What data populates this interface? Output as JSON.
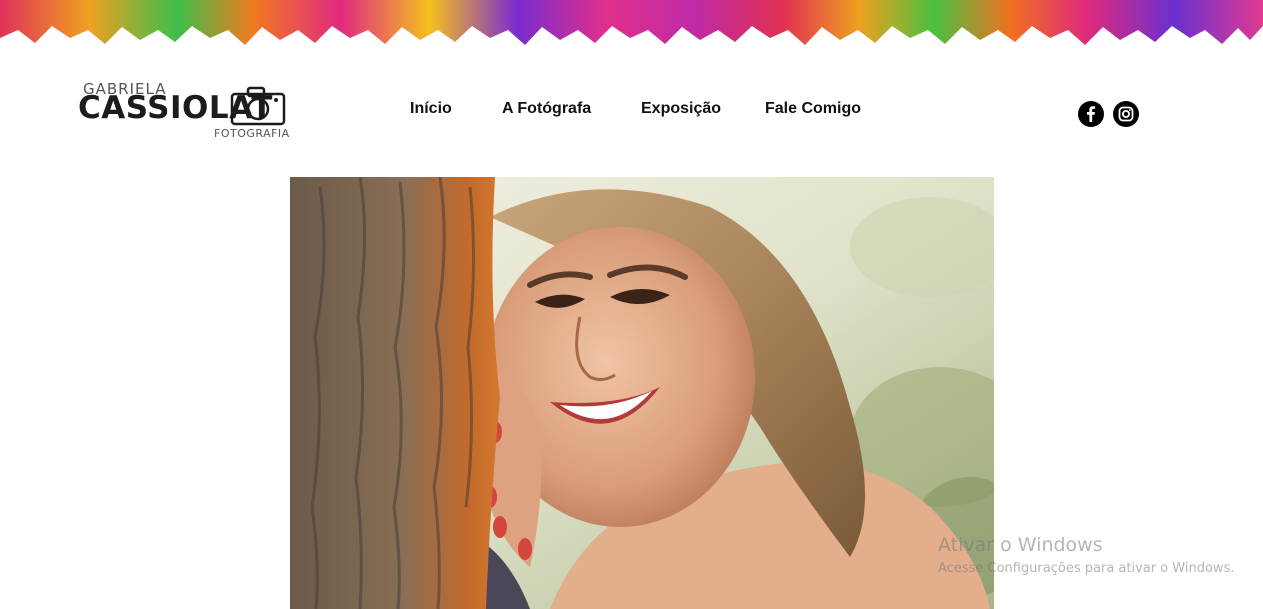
{
  "header": {
    "logo": {
      "line1": "GABRIELA",
      "line2": "CASSIOLAT",
      "line3": "FOTOGRAFIA"
    },
    "nav": [
      {
        "label": "Início"
      },
      {
        "label": "A Fotógrafa"
      },
      {
        "label": "Exposição"
      },
      {
        "label": "Fale Comigo"
      }
    ],
    "social": [
      {
        "icon": "facebook-icon"
      },
      {
        "icon": "instagram-icon"
      }
    ]
  },
  "main": {
    "photo": {
      "description_icon": "portrait-photo"
    }
  },
  "watermark": {
    "title": "Ativar o Windows",
    "subtitle": "Acesse Configurações para ativar o Windows."
  },
  "colors": {
    "text": "#111111",
    "background": "#ffffff",
    "icon_bg": "#000000"
  }
}
